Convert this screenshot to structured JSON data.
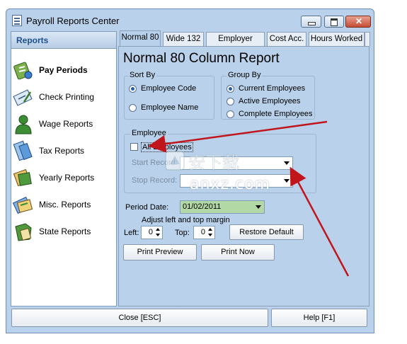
{
  "window": {
    "title": "Payroll Reports Center"
  },
  "sidebar": {
    "title": "Reports",
    "items": [
      {
        "label": "Pay Periods",
        "icon": "pay-periods-icon",
        "active": true
      },
      {
        "label": "Check Printing",
        "icon": "check-printing-icon"
      },
      {
        "label": "Wage Reports",
        "icon": "wage-reports-icon"
      },
      {
        "label": "Tax Reports",
        "icon": "tax-reports-icon"
      },
      {
        "label": "Yearly Reports",
        "icon": "yearly-reports-icon"
      },
      {
        "label": "Misc. Reports",
        "icon": "misc-reports-icon"
      },
      {
        "label": "State Reports",
        "icon": "state-reports-icon"
      }
    ]
  },
  "tabs": [
    {
      "label": "Normal 80",
      "active": true
    },
    {
      "label": "Wide 132"
    },
    {
      "label": "Employer Totals"
    },
    {
      "label": "Cost Acc."
    },
    {
      "label": "Hours Worked"
    }
  ],
  "report": {
    "title": "Normal 80 Column Report",
    "sort_by": {
      "label": "Sort By",
      "options": [
        {
          "label": "Employee Code",
          "selected": true
        },
        {
          "label": "Employee Name",
          "selected": false
        }
      ]
    },
    "group_by": {
      "label": "Group By",
      "options": [
        {
          "label": "Current Employees",
          "selected": true
        },
        {
          "label": "Active Employees",
          "selected": false
        },
        {
          "label": "Complete Employees",
          "selected": false
        }
      ]
    },
    "employee": {
      "label": "Employee",
      "all_employees": {
        "label": "All Employees",
        "checked": false
      },
      "start_record_label": "Start Record:",
      "stop_record_label": "Stop Record:"
    },
    "period_date": {
      "label": "Period Date:",
      "value": "01/02/2011"
    },
    "margin": {
      "caption": "Adjust left and top margin",
      "left_label": "Left:",
      "left_value": "0",
      "top_label": "Top:",
      "top_value": "0",
      "restore_label": "Restore Default"
    },
    "print_preview_label": "Print Preview",
    "print_now_label": "Print Now"
  },
  "footer": {
    "close_label": "Close [ESC]",
    "help_label": "Help [F1]"
  },
  "watermark": {
    "text": "anxz.com",
    "brand": "安下载"
  },
  "colors": {
    "window_bg": "#b9d1ea",
    "annotation_arrow": "#c0151b",
    "date_bg": "#b2d8a6"
  }
}
